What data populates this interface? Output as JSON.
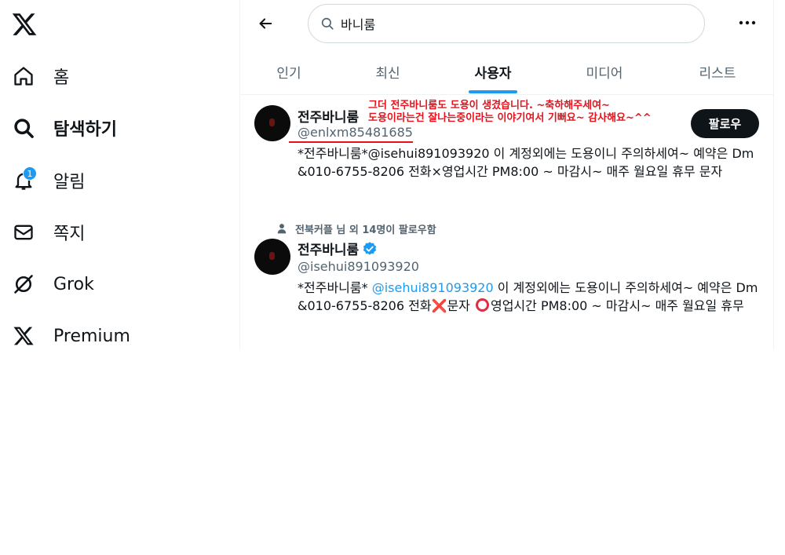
{
  "sidebar": {
    "logo_icon": "x-logo-icon",
    "items": [
      {
        "label": "홈",
        "icon": "home-icon"
      },
      {
        "label": "탐색하기",
        "icon": "search-icon",
        "active": true
      },
      {
        "label": "알림",
        "icon": "bell-icon",
        "badge": "1"
      },
      {
        "label": "쪽지",
        "icon": "envelope-icon"
      },
      {
        "label": "Grok",
        "icon": "grok-icon"
      },
      {
        "label": "Premium",
        "icon": "x-logo-icon"
      }
    ]
  },
  "header": {
    "search_value": "바니룸",
    "tabs": [
      {
        "label": "인기"
      },
      {
        "label": "최신"
      },
      {
        "label": "사용자",
        "active": true
      },
      {
        "label": "미디어"
      },
      {
        "label": "리스트"
      }
    ]
  },
  "results": [
    {
      "name": "전주바니룸",
      "handle": "@enlxm85481685",
      "follow_label": "팔로우",
      "bio": "*전주바니룸*@isehui891093920 이 계정외에는 도용이니 주의하세여~ 예약은 Dm &010-6755-8206 전화×영업시간 PM8:00 ~ 마감시~ 매주 월요일 휴무 문자",
      "annotation_line1": "그더 전주바니룸도 도용이 생겼습니다. ~축하해주세여~",
      "annotation_line2": "도용이라는건 잘나는중이라는 이야기여서 기뻐요~ 감사해요~^^"
    },
    {
      "social_context": "전북커플 님 외 14명이 팔로우함",
      "name": "전주바니룸",
      "verified": true,
      "handle": "@isehui891093920",
      "bio_prefix": "*전주바니룸* ",
      "bio_mention": "@isehui891093920",
      "bio_part2": " 이 계정외에는 도용이니 주의하세여~ 예약은 Dm &010-6755-8206 전화",
      "bio_x_emoji": "❌",
      "bio_part3": "문자 ",
      "bio_part4": "영업시간 PM8:00 ~ 마감시~ 매주 월요일 휴무"
    }
  ],
  "colors": {
    "accent": "#1d9bf0",
    "annotation": "#e8111b",
    "text_secondary": "#536471"
  }
}
